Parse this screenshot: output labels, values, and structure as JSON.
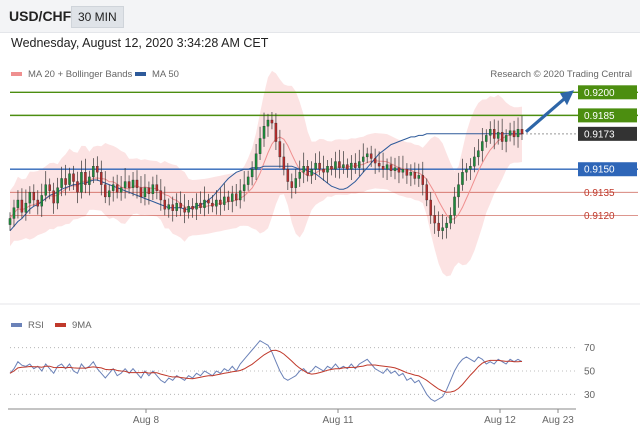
{
  "header": {
    "symbol": "USD/CHF",
    "timeframe": "30 MIN"
  },
  "datetime": "Wednesday, August 12, 2020 3:34:28 AM CET",
  "legend": {
    "ma20": "MA 20 + Bollinger Bands",
    "ma50": "MA 50",
    "ma20_color": "#ef8f8f",
    "ma50_color": "#2e5a9a",
    "credit": "Research © 2020 Trading Central"
  },
  "rsi_legend": {
    "rsi": "RSI",
    "ma9": "9MA",
    "rsi_color": "#6b82b8",
    "ma9_color": "#c0392b"
  },
  "chart_data": [
    {
      "type": "candlestick",
      "y_range": [
        0.9065,
        0.9208
      ],
      "x_ticks": [
        "Aug 8",
        "Aug 11",
        "Aug 12",
        "Aug 23"
      ],
      "price_levels": [
        {
          "label": "0.9200",
          "value": 0.92,
          "style": "resistance",
          "color": "#4c8e10"
        },
        {
          "label": "0.9185",
          "value": 0.9185,
          "style": "resistance",
          "color": "#4c8e10"
        },
        {
          "label": "0.9173",
          "value": 0.9173,
          "style": "current",
          "color": "#333333"
        },
        {
          "label": "0.9150",
          "value": 0.915,
          "style": "pivot",
          "color": "#2e66b8"
        },
        {
          "label": "0.9135",
          "value": 0.9135,
          "style": "support",
          "color": "#c0392b"
        },
        {
          "label": "0.9120",
          "value": 0.912,
          "style": "support",
          "color": "#c0392b"
        }
      ],
      "close": [
        0.9118,
        0.9125,
        0.913,
        0.9122,
        0.9128,
        0.9135,
        0.913,
        0.9126,
        0.9133,
        0.914,
        0.9136,
        0.9128,
        0.9138,
        0.9144,
        0.914,
        0.9147,
        0.9142,
        0.9135,
        0.9148,
        0.914,
        0.9145,
        0.9152,
        0.9148,
        0.914,
        0.9132,
        0.9136,
        0.914,
        0.9135,
        0.9138,
        0.9142,
        0.9138,
        0.9143,
        0.9138,
        0.9132,
        0.9138,
        0.9134,
        0.914,
        0.9136,
        0.913,
        0.9124,
        0.9127,
        0.9123,
        0.9128,
        0.9125,
        0.9122,
        0.9126,
        0.9124,
        0.9128,
        0.9125,
        0.913,
        0.9128,
        0.9126,
        0.913,
        0.9127,
        0.9132,
        0.9129,
        0.9134,
        0.913,
        0.9136,
        0.914,
        0.9145,
        0.915,
        0.916,
        0.917,
        0.9178,
        0.9182,
        0.918,
        0.9168,
        0.9158,
        0.915,
        0.9142,
        0.9138,
        0.9144,
        0.9148,
        0.9152,
        0.9146,
        0.915,
        0.9154,
        0.915,
        0.9148,
        0.9152,
        0.915,
        0.9155,
        0.9151,
        0.9153,
        0.915,
        0.9154,
        0.9151,
        0.9155,
        0.9158,
        0.916,
        0.9157,
        0.9154,
        0.9152,
        0.915,
        0.9153,
        0.9149,
        0.9151,
        0.9148,
        0.915,
        0.9146,
        0.9148,
        0.9144,
        0.9146,
        0.914,
        0.913,
        0.912,
        0.9115,
        0.911,
        0.9112,
        0.9115,
        0.912,
        0.9132,
        0.914,
        0.9148,
        0.915,
        0.9152,
        0.9158,
        0.9162,
        0.9168,
        0.9172,
        0.9176,
        0.917,
        0.9174,
        0.9168,
        0.9172,
        0.9175,
        0.9171,
        0.9176,
        0.9173
      ],
      "bollinger_ma20": [
        0.911,
        0.9113,
        0.9116,
        0.9118,
        0.9121,
        0.9124,
        0.9126,
        0.9127,
        0.9129,
        0.9131,
        0.9133,
        0.9134,
        0.9135,
        0.9137,
        0.9138,
        0.9139,
        0.914,
        0.914,
        0.9141,
        0.9141,
        0.9142,
        0.9143,
        0.9143,
        0.9142,
        0.9141,
        0.914,
        0.9139,
        0.9138,
        0.9137,
        0.9136,
        0.9135,
        0.9134,
        0.9133,
        0.9132,
        0.9131,
        0.913,
        0.9129,
        0.9128,
        0.9127,
        0.9126,
        0.9125,
        0.9125,
        0.9125,
        0.9125,
        0.9124,
        0.9124,
        0.9125,
        0.9126,
        0.9127,
        0.9128,
        0.913,
        0.9132,
        0.9135,
        0.9138,
        0.9141,
        0.9144,
        0.9146,
        0.9148,
        0.9149,
        0.915,
        0.915,
        0.9151,
        0.9151,
        0.9151,
        0.9152,
        0.9152,
        0.9152,
        0.9152,
        0.9152,
        0.9152,
        0.9152,
        0.9152,
        0.9151,
        0.915,
        0.915,
        0.9149,
        0.9148,
        0.9147,
        0.9145,
        0.9143,
        0.9141,
        0.9139,
        0.9138,
        0.9137,
        0.9137,
        0.9138,
        0.914,
        0.9142,
        0.9145,
        0.9148,
        0.9151,
        0.9154,
        0.9157,
        0.916,
        0.9162,
        0.9164,
        0.9166,
        0.9167,
        0.9168,
        0.9169,
        0.917,
        0.9171,
        0.9171,
        0.9172,
        0.9172,
        0.9173,
        0.9173,
        0.9173,
        0.9173,
        0.9173,
        0.9173,
        0.9173,
        0.9173,
        0.9173,
        0.9173,
        0.9173,
        0.9173,
        0.9173,
        0.9173,
        0.9173,
        0.9173,
        0.9173,
        0.9173,
        0.9173,
        0.9173,
        0.9173,
        0.9173,
        0.9173,
        0.9173,
        0.9173
      ]
    },
    {
      "type": "line",
      "name": "RSI",
      "y_range": [
        20,
        80
      ],
      "y_ticks": [
        70,
        50,
        30
      ],
      "rsi": [
        48,
        52,
        58,
        55,
        54,
        56,
        52,
        54,
        50,
        56,
        52,
        48,
        54,
        56,
        52,
        56,
        50,
        48,
        56,
        52,
        54,
        58,
        52,
        48,
        44,
        48,
        52,
        46,
        48,
        52,
        48,
        52,
        48,
        44,
        50,
        46,
        50,
        46,
        42,
        40,
        44,
        42,
        46,
        44,
        42,
        46,
        44,
        48,
        46,
        50,
        48,
        46,
        50,
        48,
        52,
        50,
        54,
        50,
        56,
        60,
        64,
        68,
        72,
        76,
        74,
        72,
        66,
        58,
        50,
        44,
        42,
        44,
        46,
        50,
        52,
        48,
        50,
        54,
        52,
        50,
        54,
        52,
        56,
        52,
        54,
        52,
        56,
        52,
        56,
        58,
        60,
        56,
        52,
        50,
        48,
        52,
        48,
        50,
        46,
        48,
        42,
        44,
        40,
        42,
        36,
        30,
        26,
        24,
        26,
        28,
        34,
        42,
        50,
        56,
        60,
        62,
        60,
        58,
        62,
        60,
        56,
        58,
        56,
        60,
        58,
        56,
        60,
        58,
        60,
        58
      ]
    }
  ]
}
